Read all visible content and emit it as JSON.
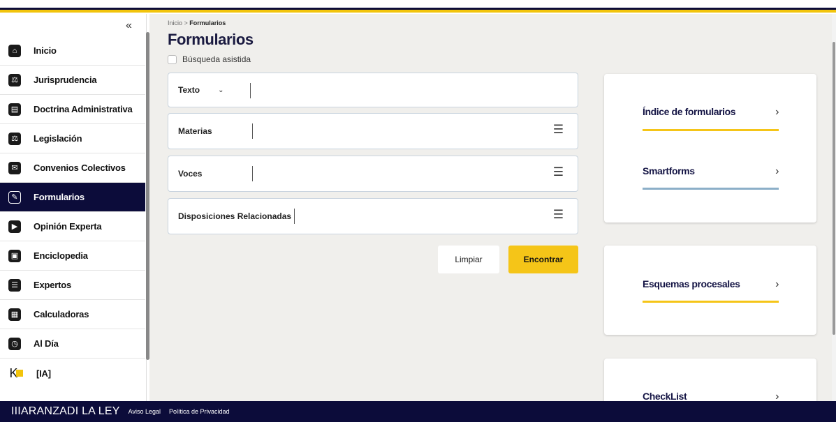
{
  "sidebar": {
    "collapse_icon": "«",
    "items": [
      {
        "label": "Inicio",
        "icon": "⌂"
      },
      {
        "label": "Jurisprudencia",
        "icon": "⚖"
      },
      {
        "label": "Doctrina Administrativa",
        "icon": "▤"
      },
      {
        "label": "Legislación",
        "icon": "⚖"
      },
      {
        "label": "Convenios Colectivos",
        "icon": "✉"
      },
      {
        "label": "Formularios",
        "icon": "✎"
      },
      {
        "label": "Opinión Experta",
        "icon": "▶"
      },
      {
        "label": "Enciclopedia",
        "icon": "▣"
      },
      {
        "label": "Expertos",
        "icon": "☰"
      },
      {
        "label": "Calculadoras",
        "icon": "▦"
      },
      {
        "label": "Al Día",
        "icon": "◷"
      },
      {
        "label": "[IA]",
        "icon": "K"
      }
    ]
  },
  "breadcrumb": {
    "home": "Inicio",
    "sep": " > ",
    "current": "Formularios"
  },
  "page": {
    "title": "Formularios",
    "assisted_search": "Búsqueda asistida"
  },
  "search": {
    "type_label": "Texto",
    "fields": [
      "Materias",
      "Voces",
      "Disposiciones Relacionadas"
    ],
    "clear": "Limpiar",
    "find": "Encontrar"
  },
  "cards": {
    "c1": [
      {
        "label": "Índice de formularios",
        "color": "#f5c518"
      },
      {
        "label": "Smartforms",
        "color": "#8cafc8"
      }
    ],
    "c2": [
      {
        "label": "Esquemas procesales",
        "color": "#f5c518"
      }
    ],
    "c3": [
      {
        "label": "CheckList",
        "color": "#f5c518"
      }
    ],
    "arrow": "›"
  },
  "footer": {
    "brand": "IIIARANZADI LA LEY",
    "legal": "Aviso Legal",
    "privacy": "Política de Privacidad"
  },
  "colors": {
    "navy": "#0c0c3a",
    "yellow": "#f5c518"
  }
}
